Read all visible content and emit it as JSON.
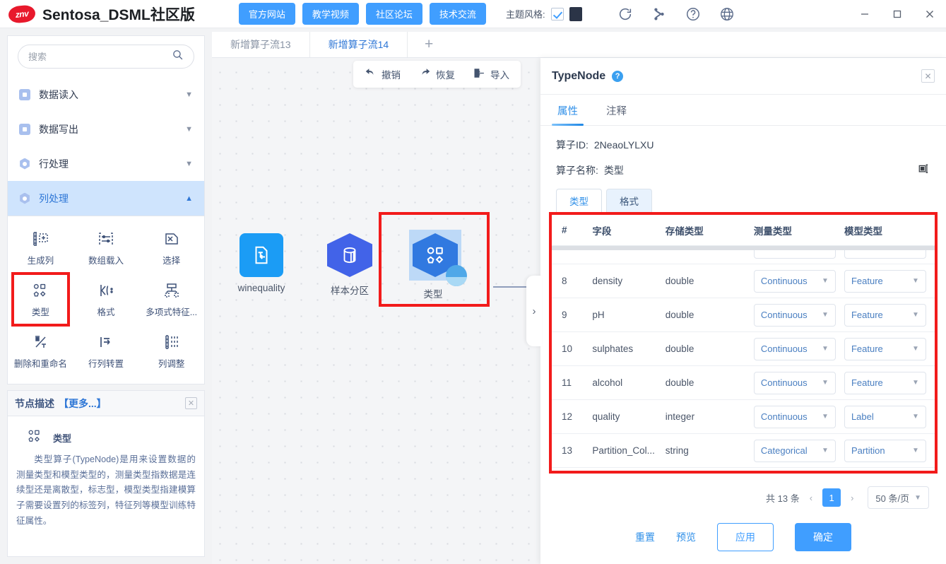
{
  "titlebar": {
    "logo_text": "znv",
    "app_title": "Sentosa_DSML社区版",
    "nav_buttons": [
      {
        "label": "官方网站"
      },
      {
        "label": "教学视频"
      },
      {
        "label": "社区论坛"
      },
      {
        "label": "技术交流"
      }
    ],
    "theme_label": "主题风格:",
    "theme_swatch_color": "#2b3447",
    "theme_checked": true,
    "icons": [
      "refresh-icon",
      "branch-icon",
      "help-icon",
      "globe-icon"
    ],
    "window_controls": [
      "minimize",
      "maximize",
      "close"
    ]
  },
  "sidebar": {
    "search_placeholder": "搜索",
    "search_value": "",
    "categories": [
      {
        "label": "数据读入",
        "icon": "square-icon",
        "expanded": false
      },
      {
        "label": "数据写出",
        "icon": "square-icon",
        "expanded": false
      },
      {
        "label": "行处理",
        "icon": "hexagon-icon",
        "expanded": false
      },
      {
        "label": "列处理",
        "icon": "hexagon-icon",
        "expanded": true
      }
    ],
    "operators": [
      {
        "label": "生成列",
        "selected": false
      },
      {
        "label": "数组载入",
        "selected": false
      },
      {
        "label": "选择",
        "selected": false
      },
      {
        "label": "类型",
        "selected": true
      },
      {
        "label": "格式",
        "selected": false
      },
      {
        "label": "多项式特征...",
        "selected": false
      },
      {
        "label": "删除和重命名",
        "selected": false
      },
      {
        "label": "行列转置",
        "selected": false
      },
      {
        "label": "列调整",
        "selected": false
      }
    ],
    "description": {
      "header": "节点描述",
      "more": "【更多...】",
      "node_title": "类型",
      "body": "类型算子(TypeNode)是用来设置数据的测量类型和模型类型的，测量类型指数据是连续型还是离散型，标志型，模型类型指建模算子需要设置列的标签列，特征列等模型训练特征属性。"
    }
  },
  "canvas": {
    "tabs": [
      {
        "label": "新增算子流13",
        "active": false
      },
      {
        "label": "新增算子流14",
        "active": true
      }
    ],
    "add_tab": "+",
    "toolbar": [
      {
        "label": "撤销",
        "icon": "undo-icon"
      },
      {
        "label": "恢复",
        "icon": "redo-icon"
      },
      {
        "label": "导入",
        "icon": "import-icon"
      }
    ],
    "nodes": [
      {
        "label": "winequality",
        "type": "source"
      },
      {
        "label": "样本分区",
        "type": "partition"
      },
      {
        "label": "类型",
        "type": "typenode",
        "selected": true
      }
    ]
  },
  "panel": {
    "title": "TypeNode",
    "tabs": [
      {
        "label": "属性",
        "active": true
      },
      {
        "label": "注释",
        "active": false
      }
    ],
    "fields": {
      "operator_id_label": "算子ID:",
      "operator_id_value": "2NeaoLYLXU",
      "operator_name_label": "算子名称:",
      "operator_name_value": "类型"
    },
    "sub_tabs": [
      {
        "label": "类型",
        "active": true
      },
      {
        "label": "格式",
        "active": false
      }
    ],
    "table": {
      "headers": [
        "#",
        "字段",
        "存储类型",
        "测量类型",
        "模型类型"
      ],
      "rows": [
        {
          "idx": "8",
          "field": "density",
          "store": "double",
          "measure": "Continuous",
          "model": "Feature"
        },
        {
          "idx": "9",
          "field": "pH",
          "store": "double",
          "measure": "Continuous",
          "model": "Feature"
        },
        {
          "idx": "10",
          "field": "sulphates",
          "store": "double",
          "measure": "Continuous",
          "model": "Feature"
        },
        {
          "idx": "11",
          "field": "alcohol",
          "store": "double",
          "measure": "Continuous",
          "model": "Feature"
        },
        {
          "idx": "12",
          "field": "quality",
          "store": "integer",
          "measure": "Continuous",
          "model": "Label"
        },
        {
          "idx": "13",
          "field": "Partition_Col...",
          "store": "string",
          "measure": "Categorical",
          "model": "Partition"
        }
      ]
    },
    "pagination": {
      "total_text": "共 13 条",
      "prev": "‹",
      "page": "1",
      "next": "›",
      "page_size": "50 条/页"
    },
    "footer": {
      "reset": "重置",
      "preview": "预览",
      "apply": "应用",
      "confirm": "确定"
    }
  }
}
